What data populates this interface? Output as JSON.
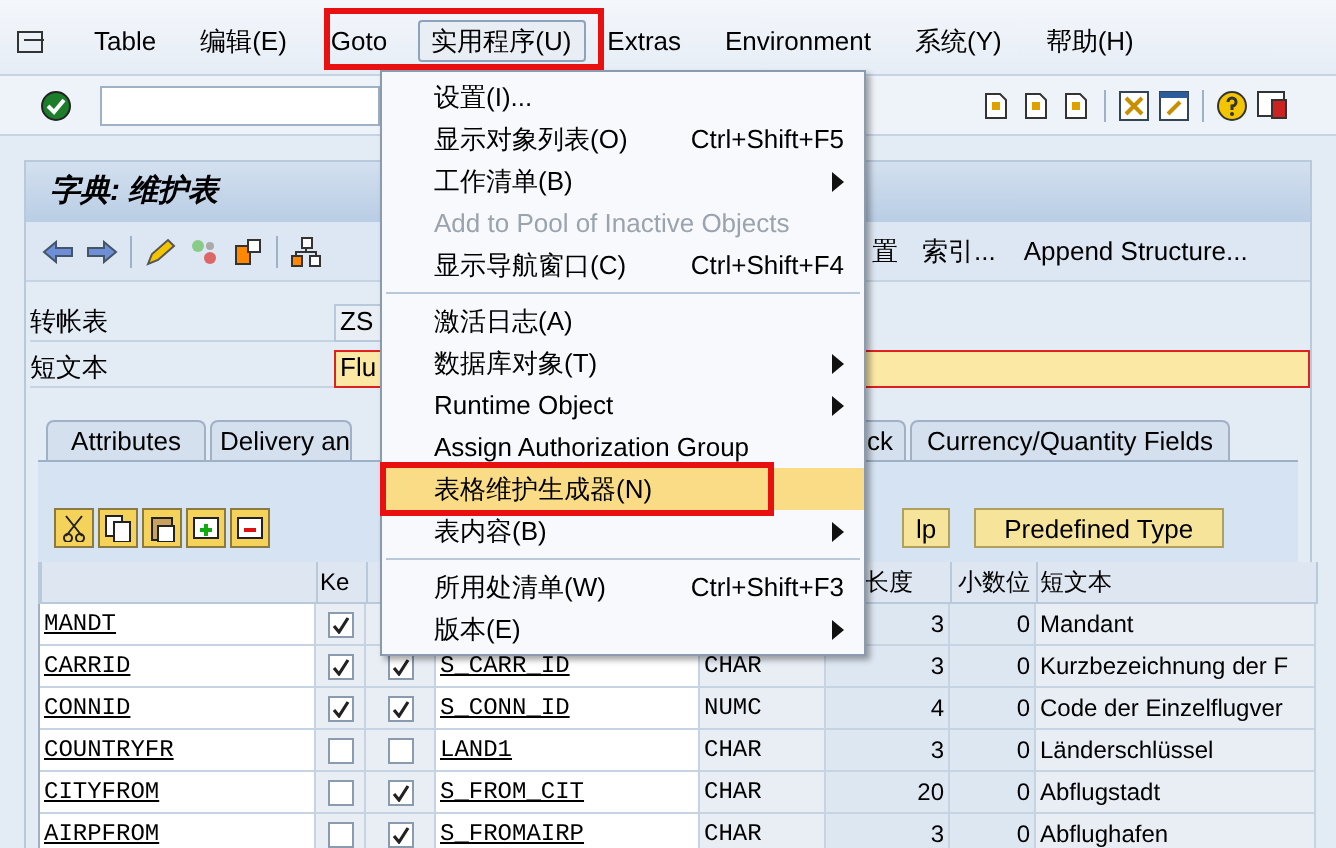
{
  "menu_bar": [
    {
      "label": "Table",
      "selected": false
    },
    {
      "label": "编辑(E)",
      "selected": false
    },
    {
      "label": "Goto",
      "selected": false
    },
    {
      "label": "实用程序(U)",
      "selected": true,
      "annotated": true
    },
    {
      "label": "Extras",
      "selected": false
    },
    {
      "label": "Environment",
      "selected": false
    },
    {
      "label": "系统(Y)",
      "selected": false
    },
    {
      "label": "帮助(H)",
      "selected": false
    }
  ],
  "title": "字典: 维护表",
  "app_toolbar": [
    "置",
    "索引...",
    "Append Structure..."
  ],
  "fields": [
    {
      "label": "转帐表",
      "value": "ZS",
      "required": false
    },
    {
      "label": "短文本",
      "value": "Flu",
      "required": true
    }
  ],
  "tabs": [
    {
      "label": "Attributes",
      "selected": false
    },
    {
      "label": "Delivery an",
      "selected": false
    },
    {
      "label": "ck",
      "selected": false
    },
    {
      "label": "Currency/Quantity Fields",
      "selected": false
    }
  ],
  "panel_buttons": [
    "lp",
    "Predefined Type"
  ],
  "table": {
    "columns": [
      "",
      "Ke",
      "",
      "",
      "",
      "长度",
      "小数位",
      "短文本"
    ],
    "rows": [
      {
        "field": "MANDT",
        "key": true,
        "initial": null,
        "data_element": "",
        "type": "",
        "length": "3",
        "decimals": "0",
        "short_text": "Mandant"
      },
      {
        "field": "CARRID",
        "key": true,
        "initial": true,
        "data_element": "S_CARR_ID",
        "type": "CHAR",
        "length": "3",
        "decimals": "0",
        "short_text": "Kurzbezeichnung der F"
      },
      {
        "field": "CONNID",
        "key": true,
        "initial": true,
        "data_element": "S_CONN_ID",
        "type": "NUMC",
        "length": "4",
        "decimals": "0",
        "short_text": "Code der Einzelflugver"
      },
      {
        "field": "COUNTRYFR",
        "key": false,
        "initial": false,
        "data_element": "LAND1",
        "type": "CHAR",
        "length": "3",
        "decimals": "0",
        "short_text": "Länderschlüssel"
      },
      {
        "field": "CITYFROM",
        "key": false,
        "initial": true,
        "data_element": "S_FROM_CIT",
        "type": "CHAR",
        "length": "20",
        "decimals": "0",
        "short_text": "Abflugstadt"
      },
      {
        "field": "AIRPFROM",
        "key": false,
        "initial": true,
        "data_element": "S_FROMAIRP",
        "type": "CHAR",
        "length": "3",
        "decimals": "0",
        "short_text": "Abflughafen"
      }
    ]
  },
  "dropdown": [
    {
      "kind": "item",
      "label": "设置(I)...",
      "disabled": false,
      "selected": false
    },
    {
      "kind": "item",
      "label": "显示对象列表(O)",
      "shortcut": "Ctrl+Shift+F5",
      "disabled": false,
      "selected": false
    },
    {
      "kind": "submenu",
      "label": "工作清单(B)",
      "disabled": false,
      "selected": false
    },
    {
      "kind": "item",
      "label": "Add to Pool of Inactive Objects",
      "disabled": true,
      "selected": false
    },
    {
      "kind": "item",
      "label": "显示导航窗口(C)",
      "shortcut": "Ctrl+Shift+F4",
      "disabled": false,
      "selected": false
    },
    {
      "kind": "separator"
    },
    {
      "kind": "item",
      "label": "激活日志(A)",
      "disabled": false,
      "selected": false
    },
    {
      "kind": "submenu",
      "label": "数据库对象(T)",
      "disabled": false,
      "selected": false
    },
    {
      "kind": "submenu",
      "label": "Runtime Object",
      "disabled": false,
      "selected": false
    },
    {
      "kind": "item",
      "label": "Assign Authorization Group",
      "disabled": false,
      "selected": false
    },
    {
      "kind": "item",
      "label": "表格维护生成器(N)",
      "disabled": false,
      "selected": true,
      "annotated": true
    },
    {
      "kind": "submenu",
      "label": "表内容(B)",
      "disabled": false,
      "selected": false
    },
    {
      "kind": "separator"
    },
    {
      "kind": "item",
      "label": "所用处清单(W)",
      "shortcut": "Ctrl+Shift+F3",
      "disabled": false,
      "selected": false
    },
    {
      "kind": "submenu",
      "label": "版本(E)",
      "disabled": false,
      "selected": false
    }
  ]
}
